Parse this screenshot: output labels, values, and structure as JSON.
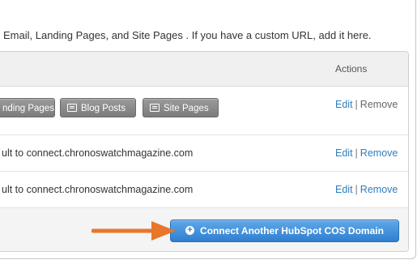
{
  "intro_text": "Email, Landing Pages, and Site Pages . If you have a custom URL, add it here.",
  "table": {
    "actions_header": "Actions",
    "rows": [
      {
        "chips": [
          "nding Pages",
          "Blog Posts",
          "Site Pages"
        ],
        "edit": "Edit",
        "sep": "|",
        "remove": "Remove"
      },
      {
        "text": "ult to connect.chronoswatchmagazine.com",
        "edit": "Edit",
        "sep": "|",
        "remove": "Remove"
      },
      {
        "text": "ult to connect.chronoswatchmagazine.com",
        "edit": "Edit",
        "sep": "|",
        "remove": "Remove"
      }
    ]
  },
  "connect_button": {
    "icon": "plus-circle-icon",
    "label": "Connect Another HubSpot COS Domain"
  },
  "annotation": {
    "icon": "orange-arrow-icon",
    "color": "#e8762b"
  },
  "colors": {
    "link": "#2f7dbd",
    "button": "#3a8ad8",
    "chip": "#8a8a8a"
  }
}
